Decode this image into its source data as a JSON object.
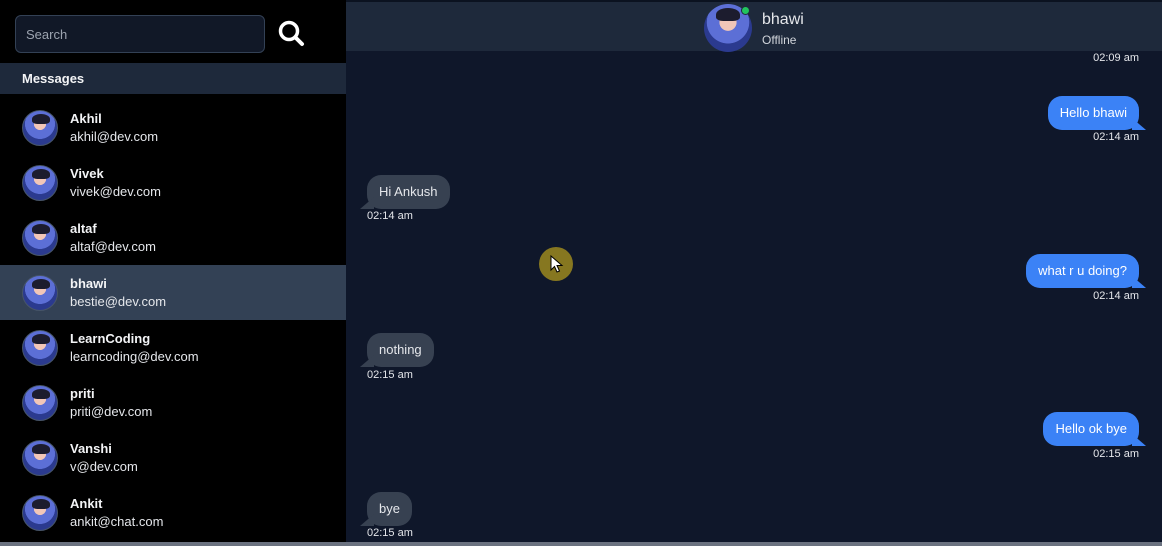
{
  "search": {
    "placeholder": "Search"
  },
  "sidebar": {
    "messages_label": "Messages",
    "contacts": [
      {
        "name": "Akhil",
        "email": "akhil@dev.com",
        "active": false
      },
      {
        "name": "Vivek",
        "email": "vivek@dev.com",
        "active": false
      },
      {
        "name": "altaf",
        "email": "altaf@dev.com",
        "active": false
      },
      {
        "name": "bhawi",
        "email": "bestie@dev.com",
        "active": true
      },
      {
        "name": "LearnCoding",
        "email": "learncoding@dev.com",
        "active": false
      },
      {
        "name": "priti",
        "email": "priti@dev.com",
        "active": false
      },
      {
        "name": "Vanshi",
        "email": "v@dev.com",
        "active": false
      },
      {
        "name": "Ankit",
        "email": "ankit@chat.com",
        "active": false
      }
    ]
  },
  "chat": {
    "header": {
      "name": "bhawi",
      "status": "Offline"
    },
    "top_time": "02:09 am",
    "messages": [
      {
        "text": "Hello bhawi",
        "time": "02:14 am",
        "direction": "out"
      },
      {
        "text": "Hi Ankush",
        "time": "02:14 am",
        "direction": "in"
      },
      {
        "text": "what r u doing?",
        "time": "02:14 am",
        "direction": "out"
      },
      {
        "text": "nothing",
        "time": "02:15 am",
        "direction": "in"
      },
      {
        "text": "Hello ok bye",
        "time": "02:15 am",
        "direction": "out"
      },
      {
        "text": "bye",
        "time": "02:15 am",
        "direction": "in"
      }
    ]
  },
  "colors": {
    "outgoing_bubble": "#3b82f6",
    "incoming_bubble": "#374151",
    "active_contact": "#334155",
    "online_indicator": "#22c55e"
  }
}
